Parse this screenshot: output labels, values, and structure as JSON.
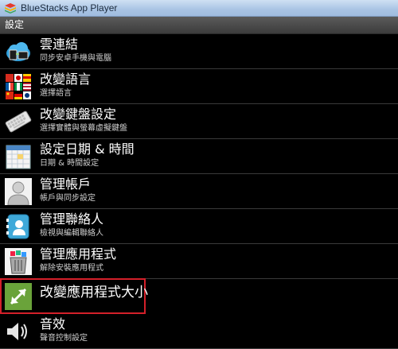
{
  "window": {
    "title": "BlueStacks App Player"
  },
  "header": {
    "title": "設定"
  },
  "items": [
    {
      "title": "雲連結",
      "subtitle": "同步安卓手機與電腦",
      "icon": "cloud-sync-icon"
    },
    {
      "title": "改變語言",
      "subtitle": "選擇語言",
      "icon": "language-flags-icon"
    },
    {
      "title": "改變鍵盤設定",
      "subtitle": "選擇實體與螢幕虛擬鍵盤",
      "icon": "keyboard-icon"
    },
    {
      "title": "設定日期 & 時間",
      "subtitle": "日期 & 時間設定",
      "icon": "calendar-icon"
    },
    {
      "title": "管理帳戶",
      "subtitle": "帳戶與同步設定",
      "icon": "account-person-icon"
    },
    {
      "title": "管理聯絡人",
      "subtitle": "檢視與編輯聯絡人",
      "icon": "contacts-icon"
    },
    {
      "title": "管理應用程式",
      "subtitle": "解除安裝應用程式",
      "icon": "trash-apps-icon"
    },
    {
      "title": "改變應用程式大小",
      "subtitle": "",
      "icon": "resize-arrows-icon"
    },
    {
      "title": "音效",
      "subtitle": "聲音控制設定",
      "icon": "speaker-icon"
    }
  ],
  "colors": {
    "highlight_border": "#d4202a",
    "resize_icon_bg": "#6aa33a"
  }
}
